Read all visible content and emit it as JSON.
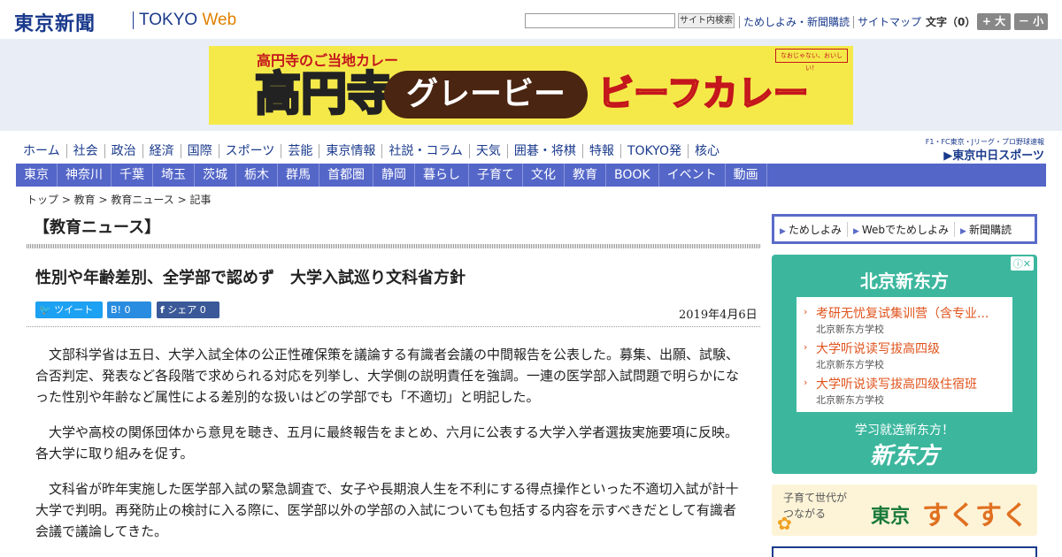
{
  "header": {
    "logo_text": "東京新聞",
    "logo_sub": "TOKYO",
    "logo_web": "Web",
    "search_button": "サイト内検索",
    "links": [
      "ためしよみ・新聞購読",
      "サイトマップ"
    ],
    "font_size_label": "文字（0）",
    "font_larger": "+ 大",
    "font_smaller": "－ 小"
  },
  "banner_ad": {
    "top_text": "高円寺のご当地カレー",
    "big_text": "高円寺",
    "pill_text": "グレービー",
    "curry_text": "ビーフカレー",
    "stamp_text": "なおじゃない、おいしい！"
  },
  "nav_primary": [
    "ホーム",
    "社会",
    "政治",
    "経済",
    "国際",
    "スポーツ",
    "芸能",
    "東京情報",
    "社説・コラム",
    "天気",
    "囲碁・将棋",
    "特報",
    "TOKYO発",
    "核心"
  ],
  "chunichi": {
    "small": "F1・FC東京・Jリーグ・プロ野球速報",
    "brand": "▶東京中日スポーツ"
  },
  "nav_secondary": [
    "東京",
    "神奈川",
    "千葉",
    "埼玉",
    "茨城",
    "栃木",
    "群馬",
    "首都圏",
    "静岡",
    "暮らし",
    "子育て",
    "文化",
    "教育",
    "BOOK",
    "イベント",
    "動画"
  ],
  "breadcrumb": "トップ > 教育 > 教育ニュース > 記事",
  "section_title": "【教育ニュース】",
  "article": {
    "headline": "性別や年齢差別、全学部で認めず　大学入試巡り文科省方針",
    "share_tweet": "ツイート",
    "share_hatena": "B! 0",
    "share_fb": "シェア 0",
    "date": "2019年4月6日",
    "paragraphs": [
      "文部科学省は五日、大学入試全体の公正性確保策を議論する有識者会議の中間報告を公表した。募集、出願、試験、合否判定、発表など各段階で求められる対応を列挙し、大学側の説明責任を強調。一連の医学部入試問題で明らかになった性別や年齢など属性による差別的な扱いはどの学部でも「不適切」と明記した。",
      "大学や高校の関係団体から意見を聴き、五月に最終報告をまとめ、六月に公表する大学入学者選抜実施要項に反映。各大学に取り組みを促す。",
      "文科省が昨年実施した医学部入試の緊急調査で、女子や長期浪人生を不利にする得点操作といった不適切入試が計十大学で判明。再発防止の検討に入る際に、医学部以外の学部の入試についても包括する内容を示すべきだとして有識者会議で議論してきた。"
    ]
  },
  "subscribe_box": [
    "ためしよみ",
    "Webでためしよみ",
    "新聞購読"
  ],
  "side_ad": {
    "title": "北京新东方",
    "items": [
      {
        "title": "考研无忧复试集训营（含专业...",
        "sub": "北京新东方学校"
      },
      {
        "title": "大学听说读写拔高四级",
        "sub": "北京新东方学校"
      },
      {
        "title": "大学听说读写拔高四级住宿班",
        "sub": "北京新东方学校"
      }
    ],
    "footer": "学习就选新东方！",
    "logo": "新东方"
  },
  "sukusuku_ad": {
    "sub": "子育て世代が\nつながる",
    "tokyo": "東京",
    "suku": "すくすく"
  },
  "colors": {
    "brand_blue": "#1a3a8c",
    "nav2_bg": "#5466c8",
    "ad_green": "#3cb79e"
  }
}
